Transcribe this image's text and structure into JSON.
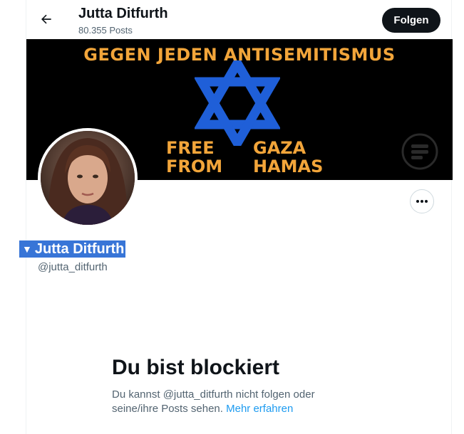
{
  "header": {
    "name": "Jutta Ditfurth",
    "posts": "80.355 Posts",
    "follow_label": "Folgen"
  },
  "banner": {
    "line_top": "GEGEN JEDEN ANTISEMITISMUS",
    "left_1": "FREE",
    "left_2": "FROM",
    "right_1": "GAZA",
    "right_2": "HAMAS",
    "text_color": "#f2a53a",
    "star_color": "#1f5fd8"
  },
  "profile": {
    "name": "Jutta Ditfurth",
    "handle": "@jutta_ditfurth",
    "selection_arrow": "▼"
  },
  "blocked": {
    "title": "Du bist blockiert",
    "text": "Du kannst @jutta_ditfurth nicht folgen oder seine/ihre Posts sehen.",
    "link": "Mehr erfahren"
  }
}
